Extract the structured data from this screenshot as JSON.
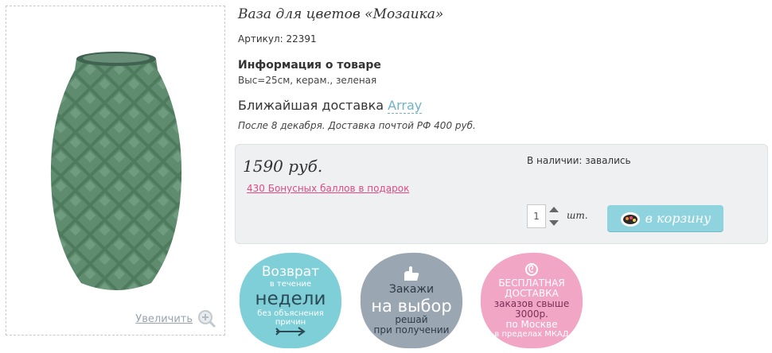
{
  "product": {
    "title": "Ваза для цветов «Мозаика»",
    "sku_label": "Артикул:",
    "sku": "22391",
    "info_heading": "Информация о товаре",
    "info_text": "Выс=25см, керам., зеленая",
    "delivery_heading": "Ближайшая доставка",
    "delivery_link": "Array",
    "delivery_text": "После 8 декабря. Доставка почтой РФ 400 руб."
  },
  "gallery": {
    "zoom_label": "Увеличить",
    "vase_color": "#4e7a5e"
  },
  "purchase": {
    "price": "1590 руб.",
    "bonus": "430 Бонусных баллов в подарок",
    "stock": "В наличии: завались",
    "quantity": "1",
    "unit": "шт.",
    "cart_button": "в корзину",
    "cart_color": "#8fd3df"
  },
  "badges": [
    {
      "color": "#7fcfd8",
      "line1": "Возврат",
      "line2": "в течение",
      "line3": "недели",
      "line4": "без объяснения",
      "line5": "причин",
      "icon": "arrow-icon"
    },
    {
      "color": "#9aa7b2",
      "line1": "Закажи",
      "line2": "на выбор",
      "line3": "решай",
      "line4": "при получении",
      "icon": "hand-icon"
    },
    {
      "color": "#f2a6c6",
      "line1": "БЕСПЛАТНАЯ",
      "line2": "ДОСТАВКА",
      "line3": "заказов свыше",
      "line4": "3000р.",
      "line5": "по Москве",
      "line6": "в пределах МКАД",
      "icon": "candy-icon"
    }
  ]
}
